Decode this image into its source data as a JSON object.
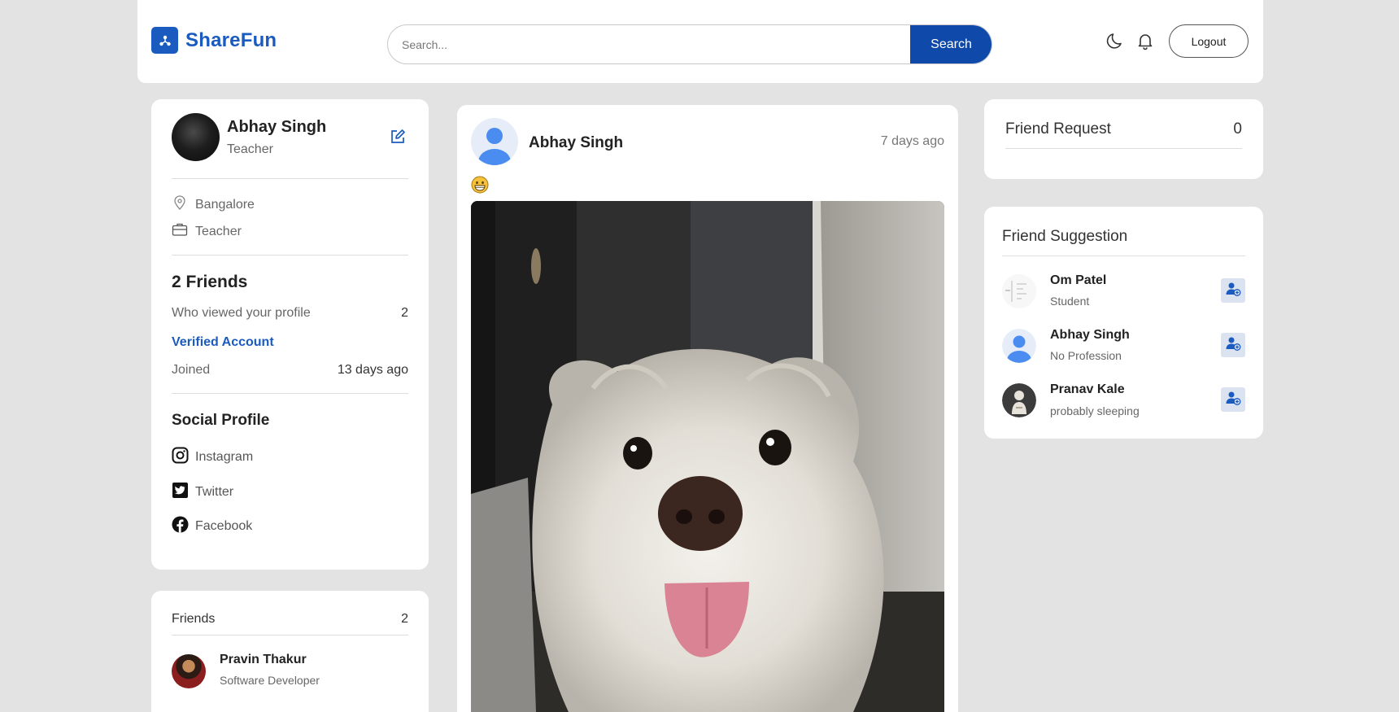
{
  "brand": {
    "name": "ShareFun"
  },
  "search": {
    "placeholder": "Search...",
    "button_label": "Search"
  },
  "header": {
    "logout_label": "Logout"
  },
  "profile": {
    "name": "Abhay Singh",
    "role": "Teacher",
    "location": "Bangalore",
    "occupation": "Teacher",
    "friends_count": "2 Friends",
    "viewed_label": "Who viewed your profile",
    "viewed_value": "2",
    "verified_label": "Verified Account",
    "joined_label": "Joined",
    "joined_value": "13 days ago"
  },
  "social": {
    "title": "Social Profile",
    "items": [
      {
        "label": "Instagram",
        "icon": "instagram-icon"
      },
      {
        "label": "Twitter",
        "icon": "twitter-icon"
      },
      {
        "label": "Facebook",
        "icon": "facebook-icon"
      }
    ]
  },
  "friends": {
    "title": "Friends",
    "count": "2",
    "items": [
      {
        "name": "Pravin Thakur",
        "role": "Software Developer"
      }
    ]
  },
  "post": {
    "author": "Abhay Singh",
    "time": "7 days ago",
    "emoji": "grinning-face-emoji",
    "image": "white-dog-photo"
  },
  "friend_request": {
    "title": "Friend Request",
    "count": "0"
  },
  "suggestions": {
    "title": "Friend Suggestion",
    "items": [
      {
        "name": "Om Patel",
        "role": "Student"
      },
      {
        "name": "Abhay Singh",
        "role": "No Profession"
      },
      {
        "name": "Pranav Kale",
        "role": "probably sleeping"
      }
    ]
  },
  "colors": {
    "brand": "#1b5bbf",
    "search_button": "#0f4aab",
    "background": "#e3e3e3"
  }
}
